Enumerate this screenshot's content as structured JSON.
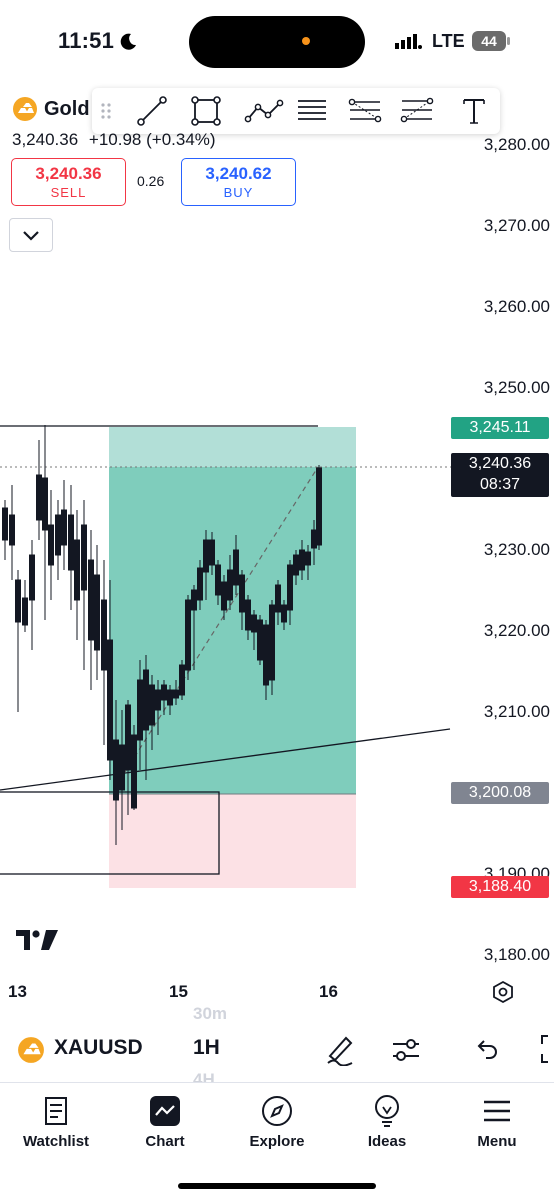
{
  "status": {
    "time": "11:51",
    "network": "LTE",
    "battery": "44"
  },
  "instrument": {
    "name": "Gold",
    "last": "3,240.36",
    "change": "+10.98 (+0.34%)",
    "sell_price": "3,240.36",
    "sell_label": "SELL",
    "spread": "0.26",
    "buy_price": "3,240.62",
    "buy_label": "BUY"
  },
  "drawing_tools": [
    "trend-line",
    "rectangle",
    "path",
    "parallel-channel",
    "fib-retracement",
    "regression-trend",
    "text"
  ],
  "price_axis": [
    "3,280.00",
    "3,270.00",
    "3,260.00",
    "3,250.00",
    "3,230.00",
    "3,220.00",
    "3,210.00",
    "3,190.00",
    "3,180.00"
  ],
  "tags": {
    "take_profit": "3,245.11",
    "last_price": "3,240.36",
    "countdown": "08:37",
    "entry": "3,200.08",
    "stop_loss": "3,188.40"
  },
  "colors": {
    "profit_zone": "#7fcfbf",
    "loss_zone": "#fbe0e4",
    "sell": "#f23645",
    "buy": "#2962ff",
    "tp_tag": "#22a384",
    "sl_tag": "#f23645",
    "entry_tag": "#808591"
  },
  "time_axis": [
    "13",
    "15",
    "16"
  ],
  "symbol_bar": {
    "symbol": "XAUUSD",
    "interval": "1H",
    "interval_above": "30m",
    "interval_below": "4H"
  },
  "tabs": [
    {
      "label": "Watchlist",
      "icon": "watchlist-icon"
    },
    {
      "label": "Chart",
      "icon": "chart-icon"
    },
    {
      "label": "Explore",
      "icon": "compass-icon"
    },
    {
      "label": "Ideas",
      "icon": "lightbulb-icon"
    },
    {
      "label": "Menu",
      "icon": "hamburger-icon"
    }
  ]
}
